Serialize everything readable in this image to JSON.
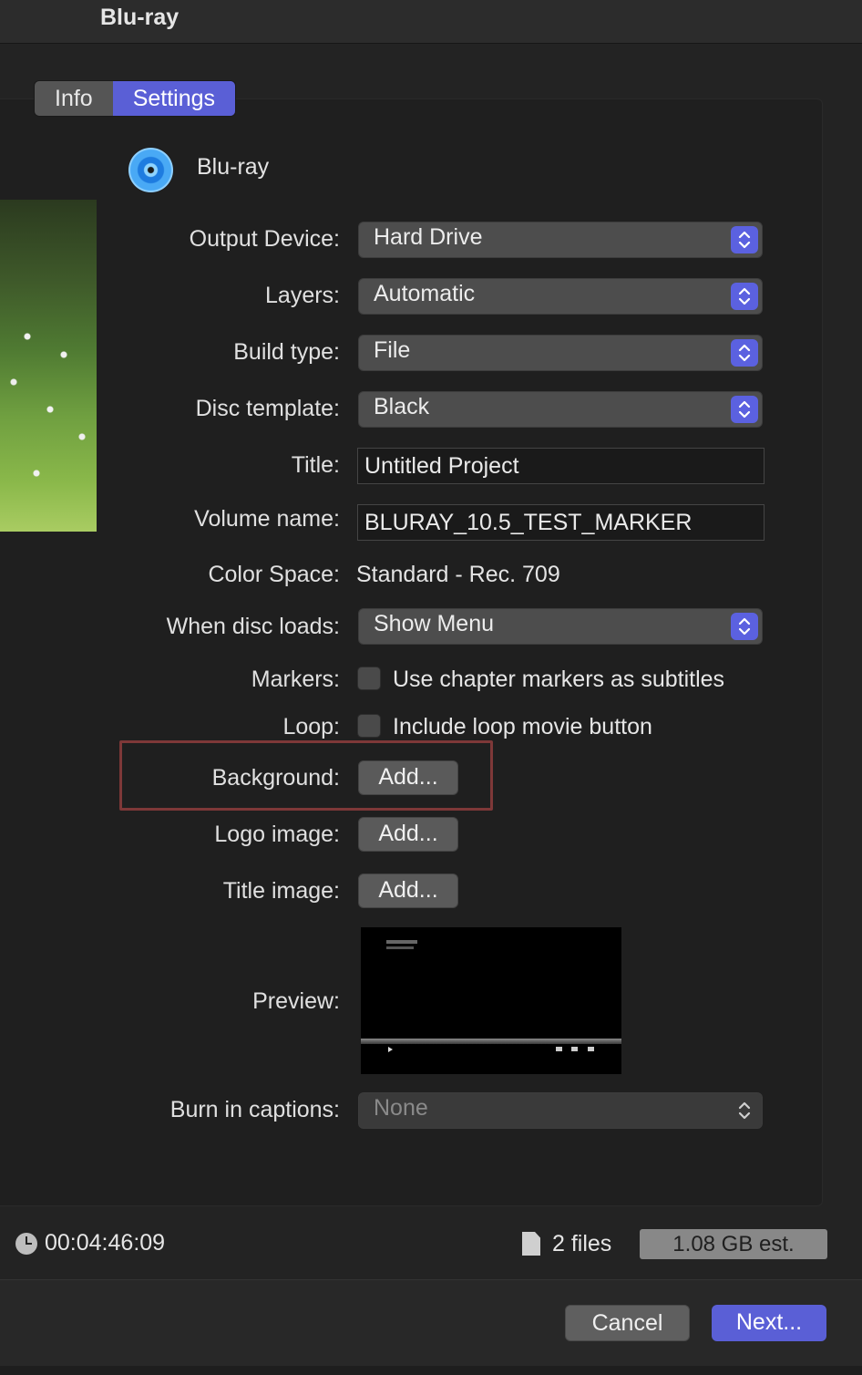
{
  "window": {
    "title": "Blu-ray"
  },
  "tabs": [
    {
      "label": "Info",
      "active": false
    },
    {
      "label": "Settings",
      "active": true
    }
  ],
  "format": {
    "label": "Blu-ray",
    "icon": "disc-icon"
  },
  "settings": {
    "output_device": {
      "label": "Output Device:",
      "value": "Hard Drive"
    },
    "layers": {
      "label": "Layers:",
      "value": "Automatic"
    },
    "build_type": {
      "label": "Build type:",
      "value": "File"
    },
    "disc_template": {
      "label": "Disc template:",
      "value": "Black"
    },
    "title": {
      "label": "Title:",
      "value": "Untitled Project"
    },
    "volume_name": {
      "label": "Volume name:",
      "value": "BLURAY_10.5_TEST_MARKER"
    },
    "color_space": {
      "label": "Color Space:",
      "value": "Standard - Rec. 709"
    },
    "when_disc_loads": {
      "label": "When disc loads:",
      "value": "Show Menu"
    },
    "markers": {
      "label": "Markers:",
      "checkbox_label": "Use chapter markers as subtitles",
      "checked": false
    },
    "loop": {
      "label": "Loop:",
      "checkbox_label": "Include loop movie button",
      "checked": false
    },
    "background": {
      "label": "Background:",
      "button": "Add..."
    },
    "logo_image": {
      "label": "Logo image:",
      "button": "Add..."
    },
    "title_image": {
      "label": "Title image:",
      "button": "Add..."
    },
    "preview": {
      "label": "Preview:"
    },
    "burn_in_captions": {
      "label": "Burn in captions:",
      "value": "None",
      "disabled": true
    }
  },
  "footer": {
    "duration": "00:04:46:09",
    "files": "2 files",
    "size": "1.08 GB est."
  },
  "actions": {
    "cancel": "Cancel",
    "next": "Next..."
  },
  "colors": {
    "accent": "#5a5fd6",
    "highlight_box": "#7e3838"
  }
}
